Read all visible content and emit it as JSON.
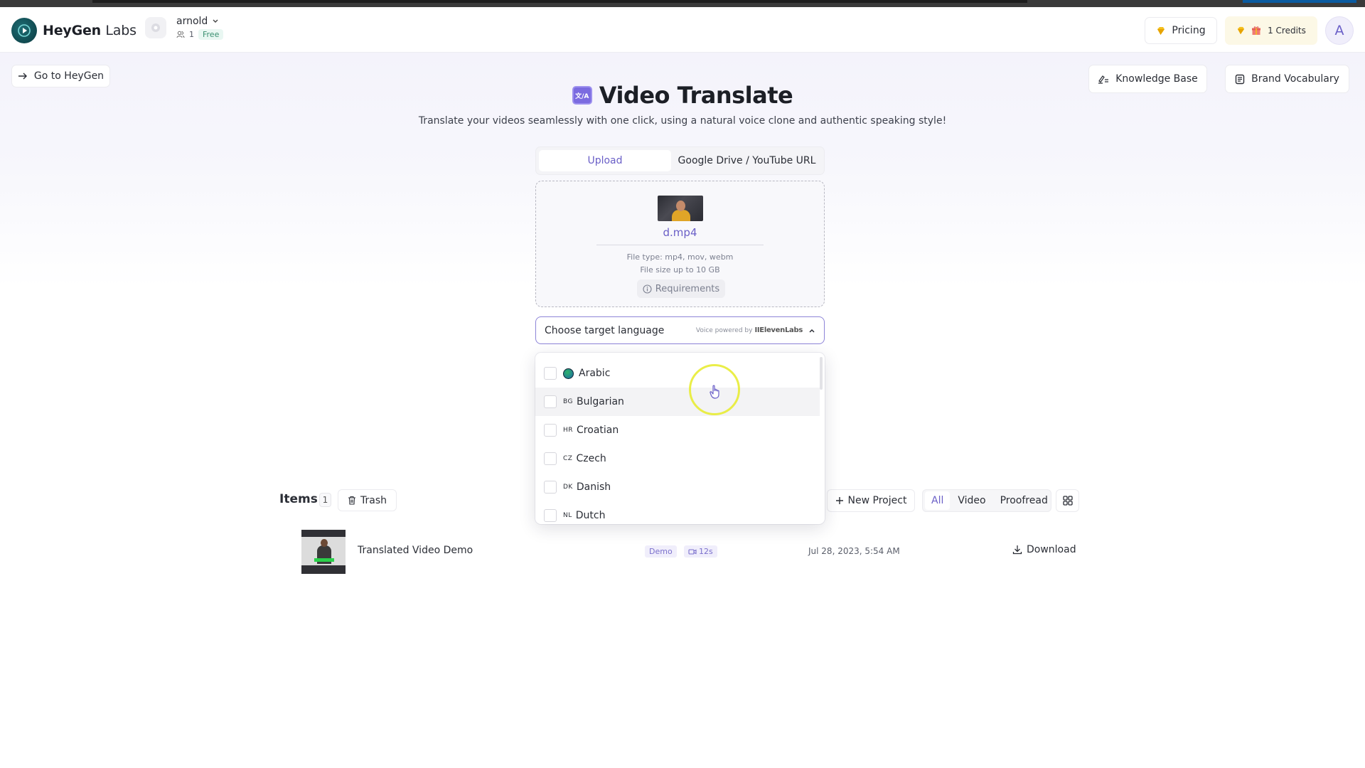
{
  "app": {
    "brand_main": "HeyGen",
    "brand_sub": "Labs",
    "workspace": {
      "name": "arnold",
      "members": "1",
      "plan": "Free"
    },
    "pricing_label": "Pricing",
    "credits_label": "1 Credits",
    "avatar_initial": "A",
    "colors": {
      "accent": "#6a5fc7",
      "brand": "#0b3a40",
      "credits_bg": "#fcf8e6",
      "free_badge": "#3a8f70"
    }
  },
  "nav": {
    "go_to_label": "Go to HeyGen",
    "knowledge_base_label": "Knowledge Base",
    "brand_vocabulary_label": "Brand Vocabulary"
  },
  "page": {
    "title_icon_text": "文/A",
    "title": "Video Translate",
    "subtitle": "Translate your videos seamlessly with one click, using a natural voice clone and authentic speaking style!"
  },
  "upload": {
    "tabs": [
      {
        "label": "Upload",
        "active": true
      },
      {
        "label": "Google Drive / YouTube URL",
        "active": false
      }
    ],
    "file_name": "d.mp4",
    "file_types": "File type: mp4, mov, webm",
    "file_size": "File size up to 10 GB",
    "requirements_label": "Requirements"
  },
  "language_select": {
    "placeholder": "Choose target language",
    "powered_by": "Voice powered by",
    "provider": "IIElevenLabs",
    "options": [
      {
        "code": "",
        "label": "Arabic",
        "icon": "globe-icon",
        "checked": false
      },
      {
        "code": "BG",
        "label": "Bulgarian",
        "checked": false,
        "hovered": true
      },
      {
        "code": "HR",
        "label": "Croatian",
        "checked": false
      },
      {
        "code": "CZ",
        "label": "Czech",
        "checked": false
      },
      {
        "code": "DK",
        "label": "Danish",
        "checked": false
      },
      {
        "code": "NL",
        "label": "Dutch",
        "checked": false
      }
    ]
  },
  "items": {
    "title": "Items",
    "count": "1",
    "trash_label": "Trash",
    "new_project_label": "New Project",
    "filters": [
      {
        "label": "All",
        "active": true
      },
      {
        "label": "Video",
        "active": false
      },
      {
        "label": "Proofread",
        "active": false
      }
    ],
    "rows": [
      {
        "name": "Translated Video Demo",
        "badge": "Demo",
        "duration": "12s",
        "date": "Jul 28, 2023, 5:54 AM",
        "action": "Download"
      }
    ]
  }
}
